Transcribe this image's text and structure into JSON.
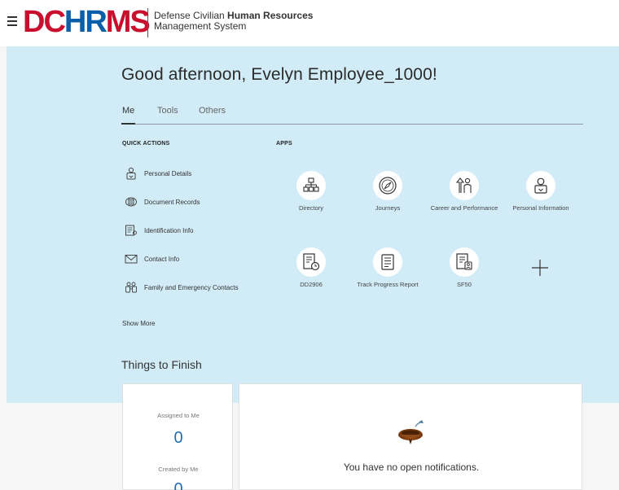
{
  "header": {
    "logo": {
      "part1": "DC",
      "part2": "HR",
      "part3": "MS"
    },
    "org_line1_prefix": "Defense Civilian ",
    "org_line1_bold": "Human Resources",
    "org_line2": "Management System"
  },
  "greeting": "Good afternoon, Evelyn Employee_1000!",
  "tabs": [
    {
      "label": "Me",
      "active": true
    },
    {
      "label": "Tools",
      "active": false
    },
    {
      "label": "Others",
      "active": false
    }
  ],
  "quick_actions": {
    "heading": "QUICK ACTIONS",
    "items": [
      {
        "label": "Personal Details",
        "icon": "person-badge-icon"
      },
      {
        "label": "Document Records",
        "icon": "document-stack-icon"
      },
      {
        "label": "Identification Info",
        "icon": "id-card-icon"
      },
      {
        "label": "Contact Info",
        "icon": "envelope-icon"
      },
      {
        "label": "Family and Emergency Contacts",
        "icon": "family-icon"
      }
    ],
    "show_more": "Show More"
  },
  "apps": {
    "heading": "APPS",
    "items": [
      {
        "label": "Directory",
        "icon": "org-chart-icon"
      },
      {
        "label": "Journeys",
        "icon": "compass-icon"
      },
      {
        "label": "Career and Performance",
        "icon": "career-growth-icon"
      },
      {
        "label": "Personal Information",
        "icon": "person-id-icon"
      },
      {
        "label": "DD2906",
        "icon": "form-clock-icon"
      },
      {
        "label": "Track Progress Report",
        "icon": "report-list-icon"
      },
      {
        "label": "SF50",
        "icon": "form-person-icon"
      }
    ],
    "add_icon": "plus-icon"
  },
  "things_to_finish": {
    "title": "Things to Finish",
    "assigned_label": "Assigned to Me",
    "assigned_count": "0",
    "created_label": "Created by Me",
    "created_count": "0",
    "empty_message": "You have no open notifications."
  },
  "colors": {
    "hero_background": "#d2ecf7",
    "logo_red": "#c8102e",
    "logo_blue": "#0b5ea8",
    "count_blue": "#1f6fb2"
  }
}
